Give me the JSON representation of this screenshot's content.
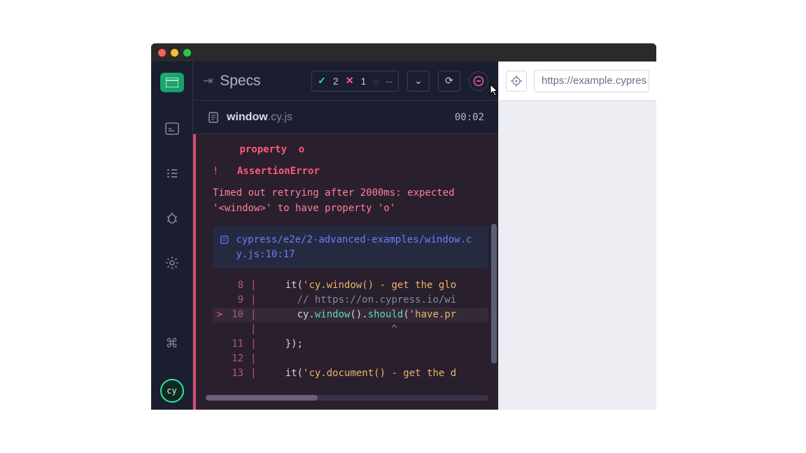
{
  "header": {
    "specs_label": "Specs",
    "pass_count": "2",
    "fail_count": "1",
    "pending_label": "--"
  },
  "file": {
    "name": "window",
    "ext": ".cy.js",
    "timer": "00:02"
  },
  "error": {
    "property_label": "property",
    "property_value": "o",
    "title": "AssertionError",
    "message": "Timed out retrying after 2000ms: expected '<window>' to have property 'o'",
    "stack_path": "cypress/e2e/2-advanced-examples/window.cy.js:10:17"
  },
  "code": {
    "lines": [
      {
        "n": "8",
        "arrow": "",
        "text_prefix": "    it(",
        "str": "'cy.window() - get the glo",
        "rest": ""
      },
      {
        "n": "9",
        "arrow": "",
        "text_prefix": "      ",
        "comment": "// https://on.cypress.io/wi"
      },
      {
        "n": "10",
        "arrow": ">",
        "text_prefix": "      cy.",
        "kw1": "window",
        "mid": "().",
        "kw2": "should",
        "rest": "(",
        "str": "'have.pr"
      },
      {
        "n": "",
        "arrow": "",
        "caret": "                      ^"
      },
      {
        "n": "11",
        "arrow": "",
        "text_prefix": "    });"
      },
      {
        "n": "12",
        "arrow": "",
        "text_prefix": ""
      },
      {
        "n": "13",
        "arrow": "",
        "text_prefix": "    it(",
        "str": "'cy.document() - get the d"
      }
    ]
  },
  "preview": {
    "url": "https://example.cypres"
  },
  "icons": {
    "logo": "cy"
  }
}
